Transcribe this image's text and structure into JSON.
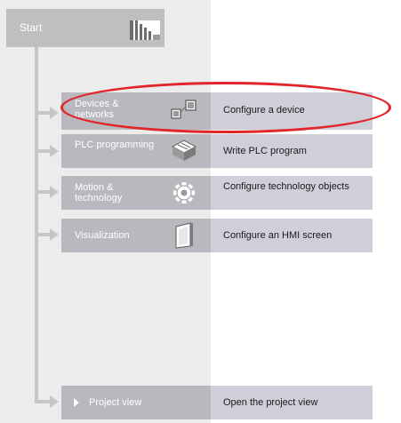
{
  "start": {
    "label": "Start"
  },
  "rows": [
    {
      "label": "Devices & networks",
      "action": "Configure a device",
      "icon": "devices-networks-icon"
    },
    {
      "label": "PLC programming",
      "action": "Write PLC program",
      "icon": "plc-programming-icon"
    },
    {
      "label": "Motion & technology",
      "action": "Configure technology objects",
      "icon": "motion-gear-icon"
    },
    {
      "label": "Visualization",
      "action": "Configure an HMI screen",
      "icon": "hmi-screen-icon"
    }
  ],
  "project_view": {
    "label": "Project view",
    "action": "Open the project view"
  },
  "colors": {
    "highlight": "#e0252b",
    "left_panel": "#ececec",
    "portal_button": "#b8b8be",
    "action_button": "#cfcfda"
  }
}
